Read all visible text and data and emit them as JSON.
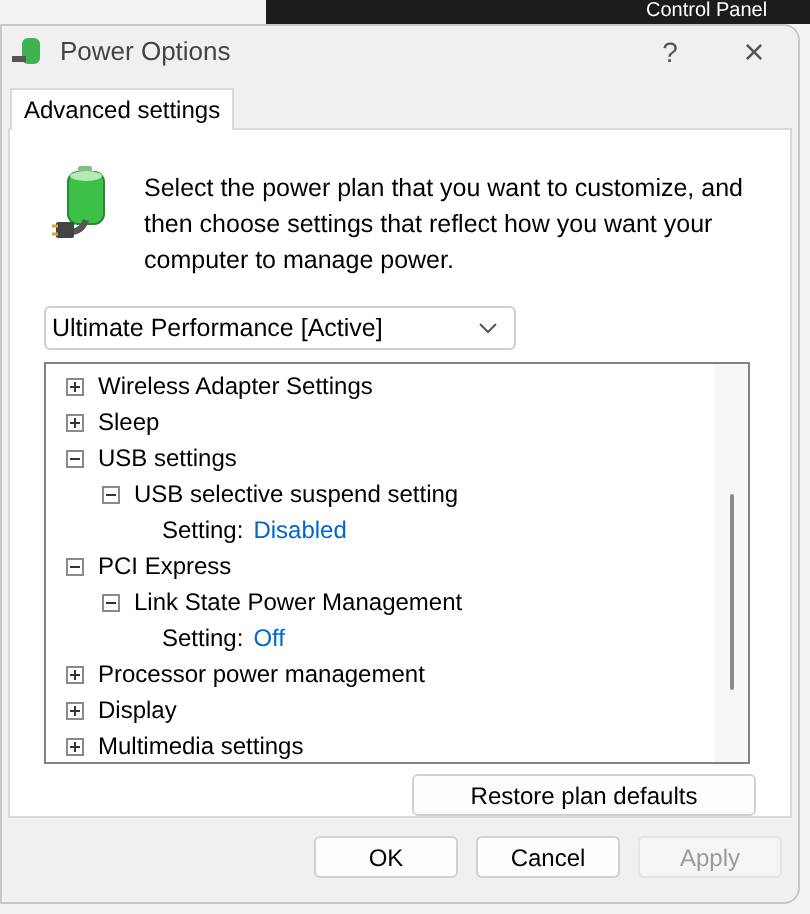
{
  "background": {
    "breadcrumb": "Control Panel"
  },
  "window": {
    "title": "Power Options",
    "help": "?",
    "close": "×"
  },
  "tabs": [
    {
      "label": "Advanced settings",
      "selected": true
    }
  ],
  "intro": "Select the power plan that you want to customize, and then choose settings that reflect how you want your computer to manage power.",
  "plan_select": {
    "value": "Ultimate Performance [Active]"
  },
  "tree": [
    {
      "kind": "group",
      "label": "Wireless Adapter Settings",
      "expanded": false
    },
    {
      "kind": "group",
      "label": "Sleep",
      "expanded": false
    },
    {
      "kind": "group",
      "label": "USB settings",
      "expanded": true,
      "children": [
        {
          "kind": "group",
          "label": "USB selective suspend setting",
          "expanded": true,
          "children": [
            {
              "kind": "setting",
              "label": "Setting:",
              "value": "Disabled"
            }
          ]
        }
      ]
    },
    {
      "kind": "group",
      "label": "PCI Express",
      "expanded": true,
      "children": [
        {
          "kind": "group",
          "label": "Link State Power Management",
          "expanded": true,
          "children": [
            {
              "kind": "setting",
              "label": "Setting:",
              "value": "Off"
            }
          ]
        }
      ]
    },
    {
      "kind": "group",
      "label": "Processor power management",
      "expanded": false
    },
    {
      "kind": "group",
      "label": "Display",
      "expanded": false
    },
    {
      "kind": "group",
      "label": "Multimedia settings",
      "expanded": false
    }
  ],
  "restore_button": "Restore plan defaults",
  "buttons": [
    {
      "label": "OK",
      "disabled": false
    },
    {
      "label": "Cancel",
      "disabled": false
    },
    {
      "label": "Apply",
      "disabled": true
    }
  ]
}
